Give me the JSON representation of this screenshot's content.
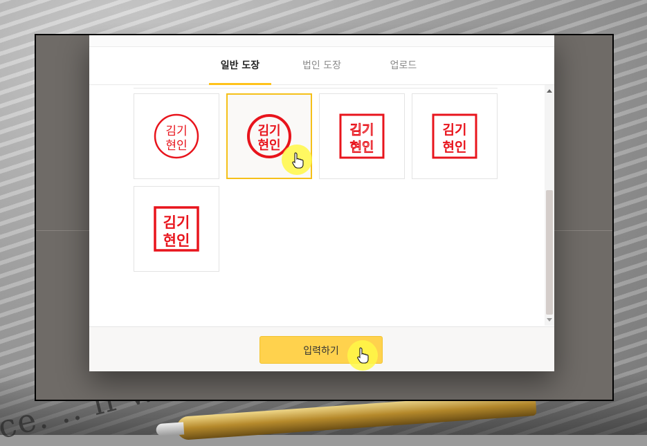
{
  "tabs": [
    {
      "label": "일반 도장",
      "active": true
    },
    {
      "label": "법인 도장",
      "active": false
    },
    {
      "label": "업로드",
      "active": false
    }
  ],
  "stamps": [
    {
      "style": "circle-thin",
      "text": [
        "김기",
        "현인"
      ]
    },
    {
      "style": "circle-bold",
      "text": [
        "김기",
        "현인"
      ],
      "selected": true
    },
    {
      "style": "square-seal-script",
      "text": [
        "김기",
        "현인"
      ]
    },
    {
      "style": "square-outline",
      "text": [
        "김기",
        "현인"
      ]
    },
    {
      "style": "square-bold",
      "text": [
        "김기",
        "현인"
      ]
    }
  ],
  "footer": {
    "submit_label": "입력하기"
  },
  "background_text": "ce. .. if wa",
  "colors": {
    "accent": "#ffc21a",
    "stamp_red": "#e8141c",
    "button": "#ffd24d"
  },
  "icons": {
    "cursor": "hand-pointer-icon",
    "scroll_up": "scroll-up-arrow-icon",
    "scroll_down": "scroll-down-arrow-icon"
  }
}
